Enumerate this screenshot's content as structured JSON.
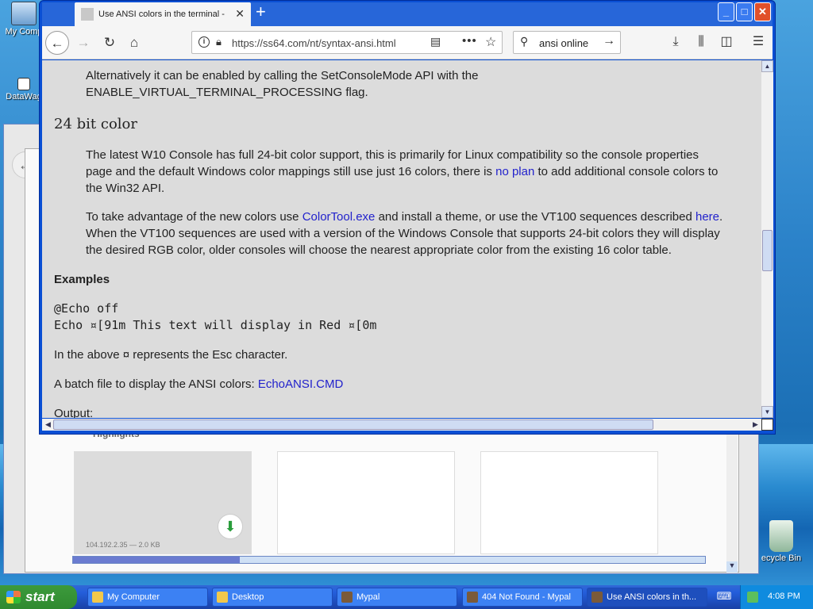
{
  "desktop": {
    "icons": [
      {
        "label": "My Comp"
      },
      {
        "label": "DataWag"
      },
      {
        "label": "ecycle Bin"
      }
    ]
  },
  "background_window": {
    "section_title": "Highlights",
    "cards": [
      {
        "meta": "104.192.2.35 — 2.0 KB"
      }
    ]
  },
  "browser": {
    "tab_title": "Use ANSI colors in the terminal - W",
    "new_tab_icon": "plus-icon",
    "caption": {
      "minimize": "_",
      "maximize": "□",
      "close": "✕"
    },
    "url": "https://ss64.com/nt/syntax-ansi.html",
    "search_query": "ansi online",
    "icons": [
      "back-arrow-icon",
      "forward-arrow-icon",
      "reload-icon",
      "home-icon",
      "info-icon",
      "lock-icon",
      "reader-view-icon",
      "more-icon",
      "bookmark-star-icon",
      "search-icon",
      "go-arrow-icon",
      "download-icon",
      "library-icon",
      "sidebar-icon",
      "menu-icon"
    ]
  },
  "page": {
    "para_enable": "Alternatively it can be enabled by calling the SetConsoleMode API with the",
    "para_enable_2": "ENABLE_VIRTUAL_TERMINAL_PROCESSING flag.",
    "h_24bit": "24 bit color",
    "para_24_a": "The latest W10 Console has full 24-bit color support, this is primarily for Linux compatibility so the console properties",
    "para_24_b": "page and the default Windows color mappings still use just 16 colors, there is ",
    "link_noplan": "no plan",
    "para_24_c": " to add additional console colors to",
    "para_24_d": "the Win32 API.",
    "para_tool_a": "To take advantage of the new colors use ",
    "link_colortool": "ColorTool.exe",
    "para_tool_b": " and install a theme, or use the VT100 sequences described ",
    "link_here": "here",
    "para_tool_c": ".",
    "para_tool_d": "When the VT100 sequences are used with a version of the Windows Console that supports 24-bit colors they will display",
    "para_tool_e": "the desired RGB color, older consoles will choose the nearest appropriate color from the existing 16 color table.",
    "h_examples": "Examples",
    "code_1": "@Echo off",
    "code_2": "Echo ¤[91m This text will display in Red ¤[0m",
    "para_esc": "In the above ¤ represents the Esc character.",
    "para_batch": "A batch file to display the ANSI colors: ",
    "link_echoansi": "EchoANSI.CMD",
    "para_output": "Output:"
  },
  "taskbar": {
    "start_label": "start",
    "tasks": [
      {
        "label": "My Computer"
      },
      {
        "label": "Desktop"
      },
      {
        "label": "Mypal"
      },
      {
        "label": "404 Not Found - Mypal"
      },
      {
        "label": "Use ANSI colors in th..."
      }
    ],
    "clock": "4:08 PM"
  }
}
